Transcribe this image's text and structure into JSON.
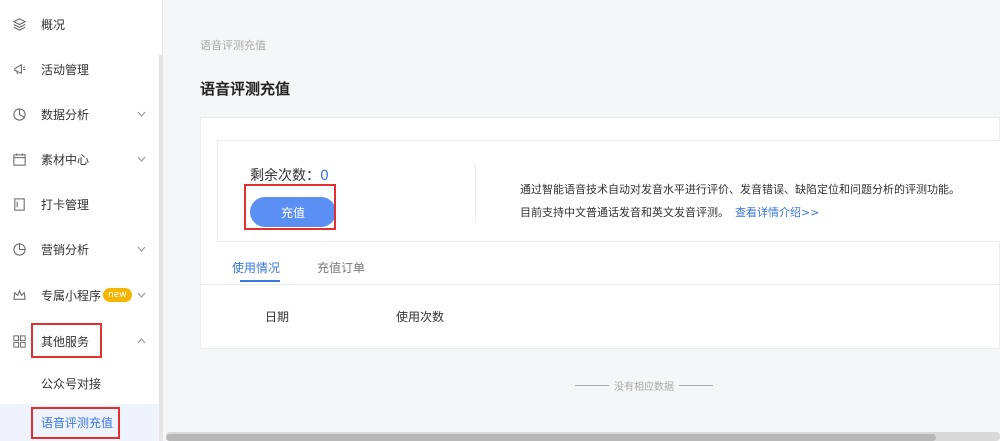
{
  "sidebar": {
    "items": [
      {
        "label": "概况",
        "icon": "layers-icon"
      },
      {
        "label": "活动管理",
        "icon": "megaphone-icon"
      },
      {
        "label": "数据分析",
        "icon": "pie-chart-icon"
      },
      {
        "label": "素材中心",
        "icon": "calendar-icon"
      },
      {
        "label": "打卡管理",
        "icon": "document-icon"
      },
      {
        "label": "营销分析",
        "icon": "chart-icon"
      },
      {
        "label": "专属小程序",
        "icon": "crown-icon",
        "badge": "new"
      },
      {
        "label": "其他服务",
        "icon": "grid-icon"
      }
    ],
    "sub_items": [
      {
        "label": "公众号对接"
      },
      {
        "label": "语音评测充值"
      }
    ]
  },
  "main": {
    "breadcrumb": "语音评测充值",
    "title": "语音评测充值",
    "remaining_label": "剩余次数：",
    "remaining_value": "0",
    "recharge_button": "充值",
    "description_line1": "通过智能语音技术自动对发音水平进行评价、发音错误、缺陷定位和问题分析的评测功能。",
    "description_line2": "目前支持中文普通话发音和英文发音评测。",
    "details_link": "查看详情介绍>>",
    "tabs": [
      {
        "label": "使用情况",
        "active": true
      },
      {
        "label": "充值订单",
        "active": false
      }
    ],
    "table_headers": [
      "日期",
      "使用次数"
    ],
    "empty_text": "没有相应数据"
  },
  "colors": {
    "accent": "#3a78e0",
    "button": "#5b8ff4",
    "badge": "#f5b500",
    "highlight_box": "#e03030"
  }
}
